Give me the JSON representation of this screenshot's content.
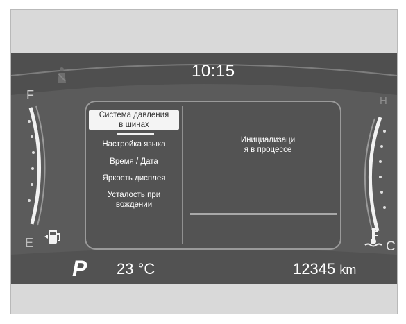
{
  "cluster": {
    "clock": "10:15",
    "gear": "P",
    "outside_temp": "23 °C",
    "odometer_value": "12345",
    "odometer_unit": "km"
  },
  "fuel_gauge": {
    "full_label": "F",
    "empty_label": "E"
  },
  "temp_gauge": {
    "hot_label": "H",
    "cold_label": "C"
  },
  "menu": {
    "items": [
      {
        "label_line1": "Система давления",
        "label_line2": "в шинах",
        "selected": true
      },
      {
        "label": "Настройка языка"
      },
      {
        "label": "Время / Дата"
      },
      {
        "label": "Яркость дисплея"
      },
      {
        "label_line1": "Усталость при",
        "label_line2": "вождении"
      }
    ]
  },
  "status": {
    "line1": "Инициализаци",
    "line2": "я в процессе",
    "progress": 0
  },
  "icons": [
    "seatbelt-warning-icon",
    "fuel-pump-icon",
    "coolant-temperature-icon"
  ],
  "colors": {
    "panel": "#5b5b5b",
    "text": "#ffffff",
    "frame": "#dcdcdc"
  }
}
